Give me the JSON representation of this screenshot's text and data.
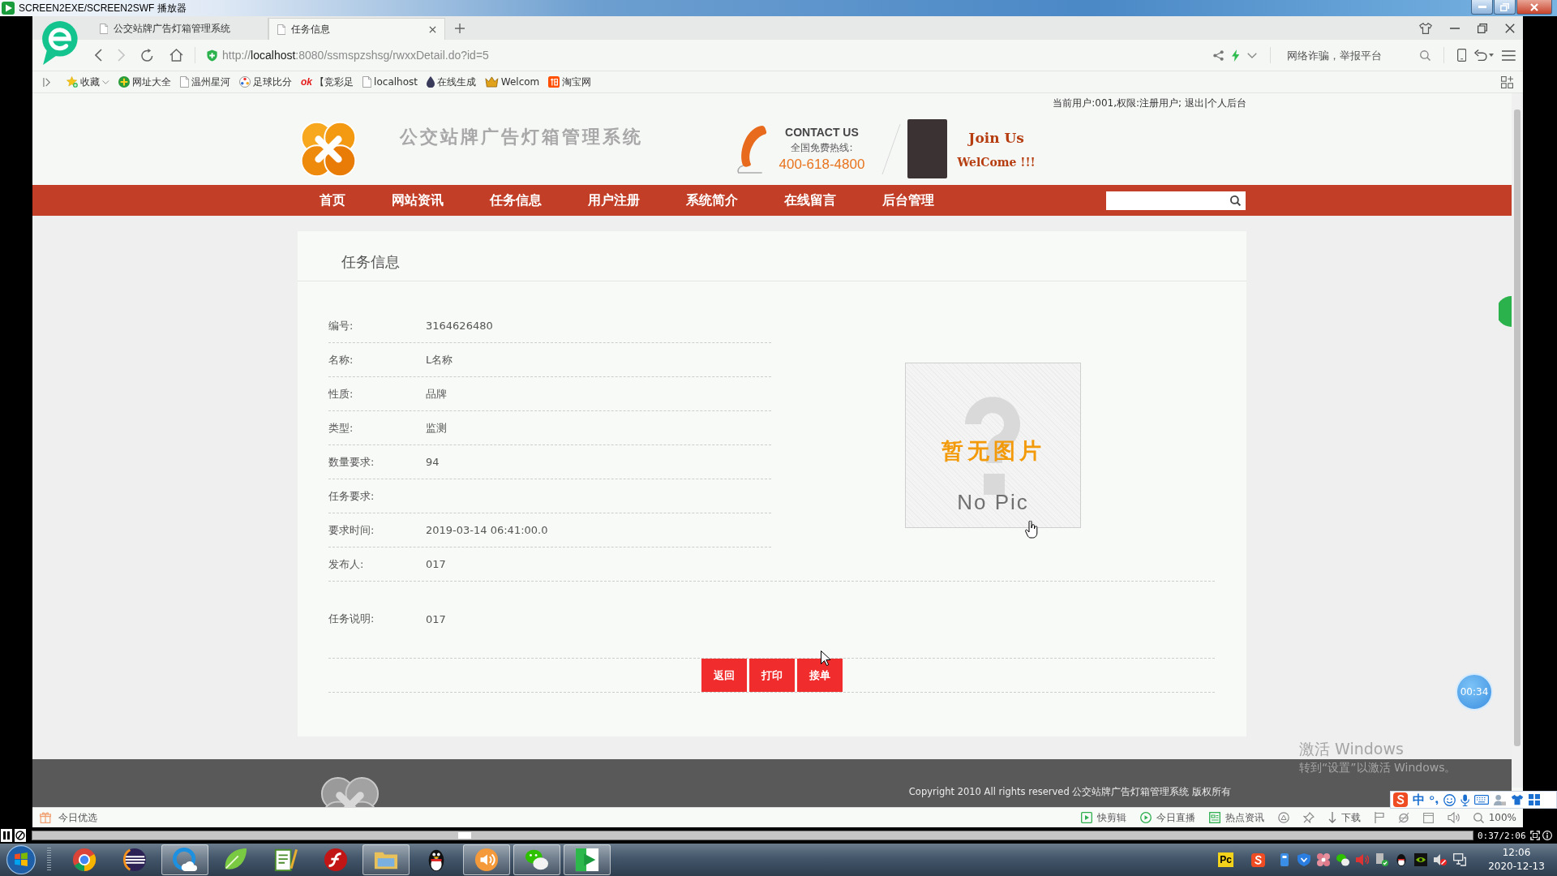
{
  "player_window": {
    "title": "SCREEN2EXE/SCREEN2SWF 播放器"
  },
  "browser": {
    "tabs": [
      {
        "title": "公交站牌广告灯箱管理系统",
        "selected": false
      },
      {
        "title": "任务信息",
        "selected": true
      }
    ],
    "address_bar": {
      "url": "http://**localhost**:8080/ssmspzshsg/rwxxDetail.do?id=5",
      "search_placeholder": "网络诈骗，举报平台"
    },
    "bookmarks": [
      {
        "label": "收藏",
        "kind": "menu"
      },
      {
        "label": "网址大全",
        "kind": "link"
      },
      {
        "label": "温州星河",
        "kind": "link"
      },
      {
        "label": "足球比分",
        "kind": "link"
      },
      {
        "label": "【竞彩足",
        "kind": "link",
        "logo": "ok"
      },
      {
        "label": "localhost",
        "kind": "link"
      },
      {
        "label": "在线生成",
        "kind": "link"
      },
      {
        "label": "Welcom",
        "kind": "link"
      },
      {
        "label": "淘宝网",
        "kind": "link"
      }
    ],
    "status_bar": {
      "left": "今日优选",
      "items": [
        {
          "label": "快剪辑"
        },
        {
          "label": "今日直播"
        },
        {
          "label": "热点资讯"
        },
        {
          "label": "下载"
        }
      ],
      "zoom": "100%"
    }
  },
  "page": {
    "user_bar": "当前用户:001,权限:注册用户; 退出|个人后台",
    "site_title": "公交站牌广告灯箱管理系统",
    "contact": {
      "heading": "CONTACT US",
      "hotline_label": "全国免费热线:",
      "phone": "400-618-4800"
    },
    "join": {
      "title": "Join Us",
      "subtitle": "WelCome !!!"
    },
    "nav": [
      "首页",
      "网站资讯",
      "任务信息",
      "用户注册",
      "系统简介",
      "在线留言",
      "后台管理"
    ],
    "panel_title": "任务信息",
    "fields": [
      {
        "label": "编号:",
        "value": "3164626480"
      },
      {
        "label": "名称:",
        "value": "L名称"
      },
      {
        "label": "性质:",
        "value": "品牌"
      },
      {
        "label": "类型:",
        "value": "监测"
      },
      {
        "label": "数量要求:",
        "value": "94"
      },
      {
        "label": "任务要求:"
      },
      {
        "label": "要求时间:",
        "value": "2019-03-14 06:41:00.0"
      },
      {
        "label": "发布人:",
        "value": "017"
      }
    ],
    "description": {
      "label": "任务说明:",
      "value": "017"
    },
    "image_placeholder": {
      "title": "暂无图片",
      "subtitle": "No Pic"
    },
    "buttons": [
      "返回",
      "打印",
      "接单"
    ],
    "footer": {
      "copyright": "Copyright 2010 All rights reserved 公交站牌广告灯箱管理系统 版权所有"
    }
  },
  "timer_badge": {
    "time": "00:34"
  },
  "windows_watermark": {
    "title": "激活 Windows",
    "hint": "转到“设置”以激活 Windows。"
  },
  "ime_toolbar": {
    "mode": "中"
  },
  "player_controls": {
    "level": 0.3,
    "time": "0:37/2:06"
  },
  "taskbar": {
    "apps": [
      {
        "running": false
      },
      {
        "running": false
      },
      {
        "running": true
      },
      {
        "running": false
      },
      {
        "running": false
      },
      {
        "running": false
      },
      {
        "running": true
      },
      {
        "running": false
      },
      {
        "running": true
      },
      {
        "running": true
      },
      {
        "running": true
      }
    ],
    "tray_label": "Pc",
    "clock": {
      "time": "12:06",
      "date": "2020-12-13"
    }
  }
}
